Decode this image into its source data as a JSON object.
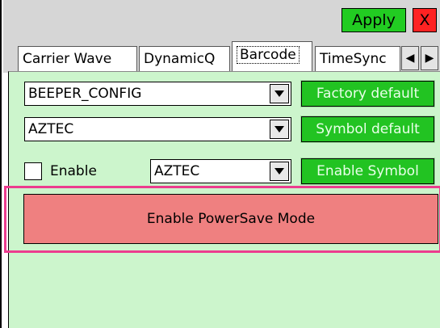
{
  "titlebar": {
    "apply_label": "Apply",
    "close_label": "X"
  },
  "tabs": [
    {
      "label": "Carrier Wave"
    },
    {
      "label": "DynamicQ"
    },
    {
      "label": "Barcode",
      "selected": true
    },
    {
      "label": "TimeSync"
    }
  ],
  "tab_scroll": {
    "left": "◀",
    "right": "▶"
  },
  "barcode": {
    "config_select": "BEEPER_CONFIG",
    "symbology_select": "AZTEC",
    "enable_checkbox_label": "Enable",
    "enable_checked": false,
    "enable_symbol_select": "AZTEC",
    "factory_default_button": "Factory default",
    "symbol_default_button": "Symbol default",
    "enable_symbol_button": "Enable Symbol",
    "powersave_button": "Enable PowerSave Mode"
  },
  "colors": {
    "panel_bg": "#ccf5cc",
    "green_button": "#22c322",
    "apply_green": "#22cc22",
    "close_red": "#ff2222",
    "powersave_bg": "#ef8080",
    "highlight": "#ec3c8e"
  }
}
